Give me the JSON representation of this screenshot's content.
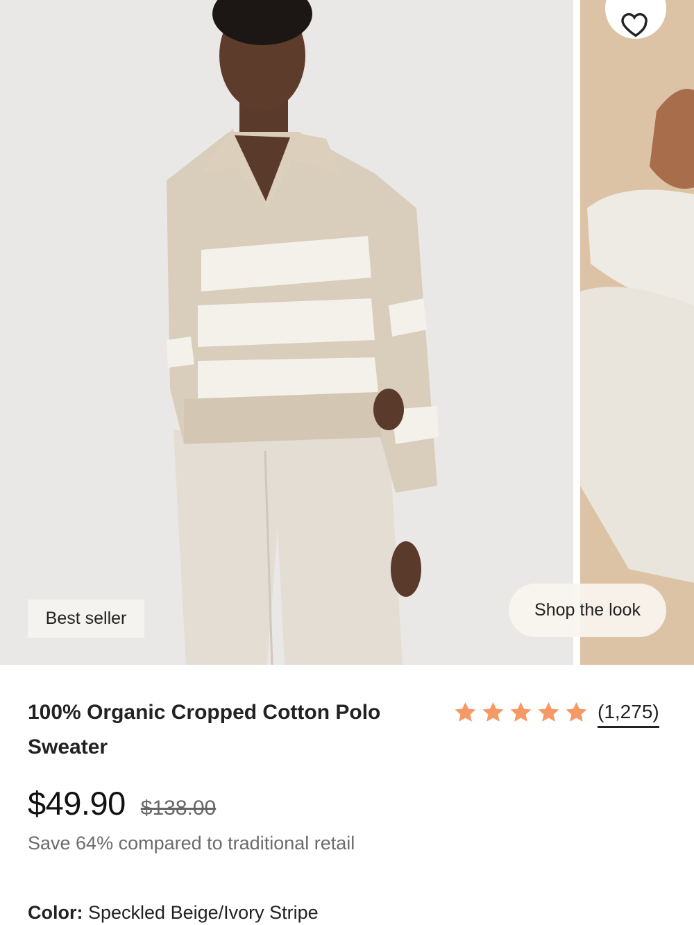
{
  "product": {
    "badge": "Best seller",
    "shop_the_look": "Shop the look",
    "title": "100% Organic Cropped Cotton Polo Sweater",
    "rating": 5,
    "review_count": "(1,275)",
    "price": "$49.90",
    "original_price": "$138.00",
    "savings_text": "Save 64% compared to traditional retail",
    "color_label": "Color:",
    "color_value": "Speckled Beige/Ivory Stripe"
  },
  "icons": {
    "wishlist": "heart-outline-icon",
    "star": "star-filled-icon"
  },
  "colors": {
    "star": "#f59a66",
    "text_primary": "#222222",
    "text_secondary": "#6b6b6b",
    "badge_bg": "#f5f3ef"
  }
}
